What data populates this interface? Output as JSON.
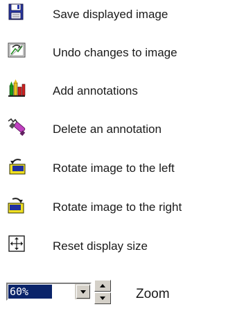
{
  "items": [
    {
      "icon": "save-disk-icon",
      "label": "Save displayed image"
    },
    {
      "icon": "undo-edit-icon",
      "label": "Undo changes to image"
    },
    {
      "icon": "add-annotations-icon",
      "label": "Add annotations"
    },
    {
      "icon": "delete-annotation-icon",
      "label": "Delete an annotation"
    },
    {
      "icon": "rotate-left-icon",
      "label": "Rotate image to the left"
    },
    {
      "icon": "rotate-right-icon",
      "label": "Rotate image to the right"
    },
    {
      "icon": "reset-size-icon",
      "label": "Reset display size"
    }
  ],
  "zoom": {
    "value": "60%",
    "label": "Zoom"
  }
}
